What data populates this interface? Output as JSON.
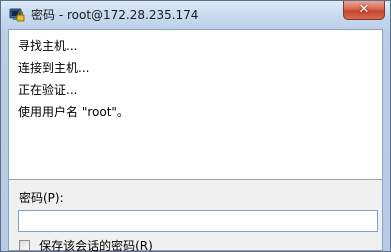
{
  "window": {
    "title": "密码 - root@172.28.235.174",
    "close_label": "✕"
  },
  "log": {
    "lines": [
      "寻找主机...",
      "连接到主机...",
      "正在验证...",
      "使用用户名 \"root\"。"
    ]
  },
  "password": {
    "label": "密码(P):",
    "value": "",
    "placeholder": ""
  },
  "save_session": {
    "label": "保存该会话的密码(R)",
    "checked": false
  },
  "colors": {
    "titlebar": "#c6d9ee",
    "close_button": "#c6432b",
    "input_border": "#7da2ce"
  }
}
